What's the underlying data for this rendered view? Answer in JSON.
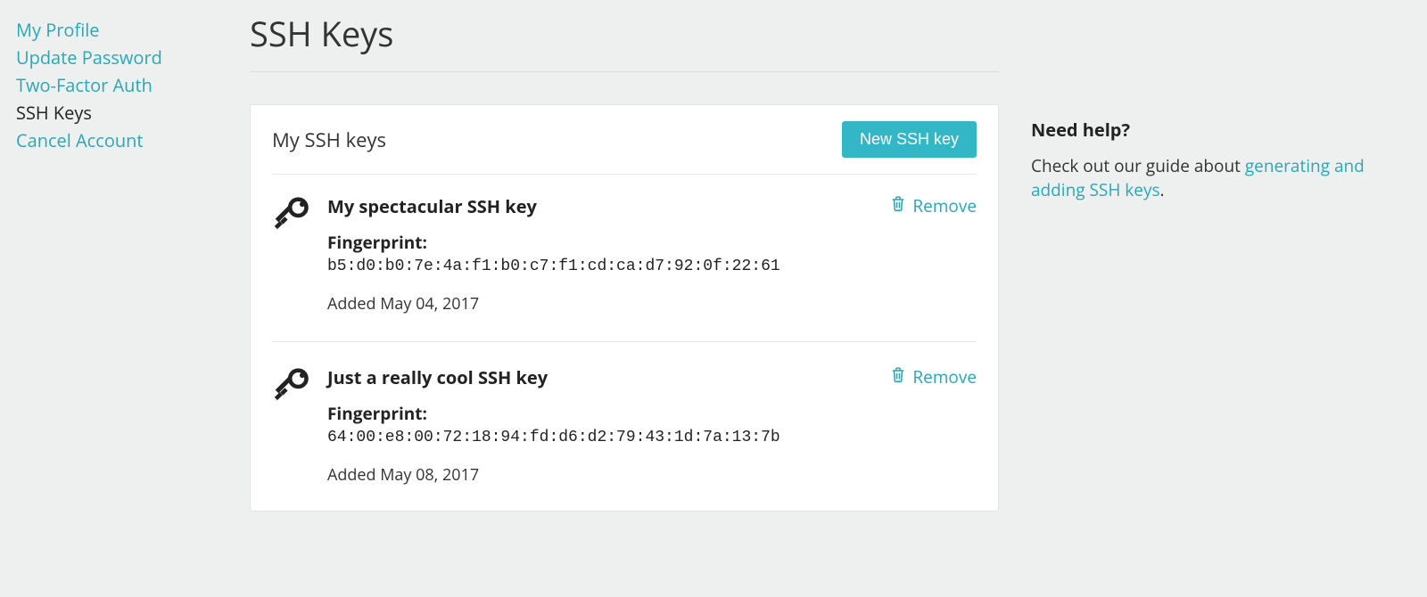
{
  "sidebar": {
    "items": [
      {
        "label": "My Profile",
        "active": false
      },
      {
        "label": "Update Password",
        "active": false
      },
      {
        "label": "Two-Factor Auth",
        "active": false
      },
      {
        "label": "SSH Keys",
        "active": true
      },
      {
        "label": "Cancel Account",
        "active": false
      }
    ]
  },
  "page": {
    "title": "SSH Keys"
  },
  "panel": {
    "title": "My SSH keys",
    "new_button": "New SSH key",
    "fingerprint_label": "Fingerprint:",
    "added_prefix": "Added ",
    "remove_label": "Remove"
  },
  "keys": [
    {
      "name": "My spectacular SSH key",
      "fingerprint": "b5:d0:b0:7e:4a:f1:b0:c7:f1:cd:ca:d7:92:0f:22:61",
      "added": "May 04, 2017"
    },
    {
      "name": "Just a really cool SSH key",
      "fingerprint": "64:00:e8:00:72:18:94:fd:d6:d2:79:43:1d:7a:13:7b",
      "added": "May 08, 2017"
    }
  ],
  "help": {
    "title": "Need help?",
    "text_before": "Check out our guide about ",
    "link": "generating and adding SSH keys",
    "text_after": "."
  }
}
